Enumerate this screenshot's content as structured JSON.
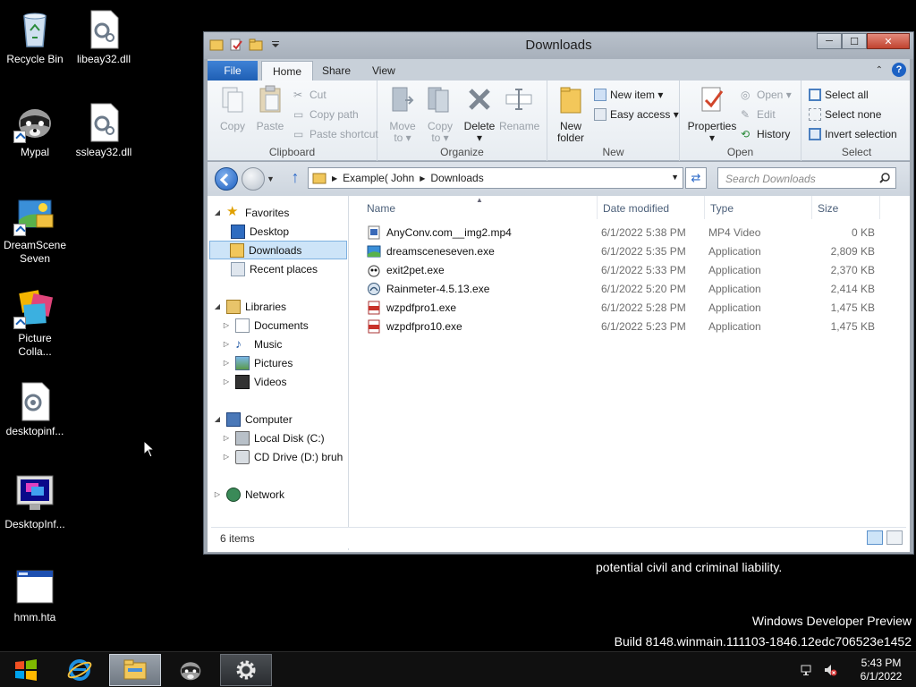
{
  "desktop": {
    "icons": [
      {
        "label": "Recycle Bin",
        "icon": "recycle-bin-icon"
      },
      {
        "label": "libeay32.dll",
        "icon": "dll-file-icon"
      },
      {
        "label": "Mypal",
        "icon": "mypal-raccoon-icon"
      },
      {
        "label": "ssleay32.dll",
        "icon": "dll-file-icon"
      },
      {
        "label": "DreamScene Seven",
        "icon": "dreamscene-icon"
      },
      {
        "label": "Picture Colla...",
        "icon": "picture-collage-icon"
      },
      {
        "label": "desktopinf...",
        "icon": "config-file-icon"
      },
      {
        "label": "DesktopInf...",
        "icon": "monitor-icon"
      },
      {
        "label": "hmm.hta",
        "icon": "hta-window-icon"
      }
    ],
    "watermark": {
      "partial_line": "potential civil and criminal liability.",
      "line1": "Windows Developer Preview",
      "line2": "Build 8148.winmain.111103-1846.12edc706523e1452"
    }
  },
  "window": {
    "title": "Downloads",
    "controls": {
      "minimize": "─",
      "maximize": "☐",
      "close": "✕"
    },
    "ribbon_tabs": [
      "File",
      "Home",
      "Share",
      "View"
    ],
    "active_tab": "Home",
    "ribbon": {
      "clipboard": {
        "label": "Clipboard",
        "copy": "Copy",
        "paste": "Paste",
        "cut": "Cut",
        "copy_path": "Copy path",
        "paste_shortcut": "Paste shortcut"
      },
      "organize": {
        "label": "Organize",
        "move_to": "Move",
        "move_to2": "to ▾",
        "copy_to": "Copy",
        "copy_to2": "to ▾",
        "delete": "Delete",
        "delete2": "▾",
        "rename": "Rename"
      },
      "new": {
        "label": "New",
        "new_folder": "New",
        "new_folder2": "folder",
        "new_item": "New item ▾",
        "easy_access": "Easy access ▾"
      },
      "open": {
        "label": "Open",
        "properties": "Properties",
        "properties2": "▾",
        "open": "Open ▾",
        "edit": "Edit",
        "history": "History"
      },
      "select": {
        "label": "Select",
        "select_all": "Select all",
        "select_none": "Select none",
        "invert": "Invert selection"
      }
    },
    "address": {
      "path": [
        "Example( John",
        "Downloads"
      ],
      "search_placeholder": "Search Downloads"
    },
    "nav_pane": {
      "favorites": "Favorites",
      "desktop": "Desktop",
      "downloads": "Downloads",
      "recent": "Recent places",
      "libraries": "Libraries",
      "documents": "Documents",
      "music": "Music",
      "pictures": "Pictures",
      "videos": "Videos",
      "computer": "Computer",
      "local_disk": "Local Disk (C:)",
      "cd_drive": "CD Drive (D:) bruh",
      "network": "Network"
    },
    "columns": {
      "name": "Name",
      "date": "Date modified",
      "type": "Type",
      "size": "Size"
    },
    "files": [
      {
        "name": "AnyConv.com__img2.mp4",
        "date": "6/1/2022 5:38 PM",
        "type": "MP4 Video",
        "size": "0 KB",
        "icon": "video-file-icon"
      },
      {
        "name": "dreamsceneseven.exe",
        "date": "6/1/2022 5:35 PM",
        "type": "Application",
        "size": "2,809 KB",
        "icon": "dreamscene-exe-icon"
      },
      {
        "name": "exit2pet.exe",
        "date": "6/1/2022 5:33 PM",
        "type": "Application",
        "size": "2,370 KB",
        "icon": "pet-exe-icon"
      },
      {
        "name": "Rainmeter-4.5.13.exe",
        "date": "6/1/2022 5:20 PM",
        "type": "Application",
        "size": "2,414 KB",
        "icon": "rainmeter-exe-icon"
      },
      {
        "name": "wzpdfpro1.exe",
        "date": "6/1/2022 5:28 PM",
        "type": "Application",
        "size": "1,475 KB",
        "icon": "pdf-exe-icon"
      },
      {
        "name": "wzpdfpro10.exe",
        "date": "6/1/2022 5:23 PM",
        "type": "Application",
        "size": "1,475 KB",
        "icon": "pdf-exe-icon"
      }
    ],
    "status": "6 items"
  },
  "taskbar": {
    "buttons": [
      "start-orb-icon",
      "internet-explorer-icon",
      "file-explorer-icon",
      "mypal-raccoon-icon",
      "settings-gear-icon"
    ],
    "clock_time": "5:43 PM",
    "clock_date": "6/1/2022"
  },
  "colors": {
    "accent": "#1f5fb4",
    "selection": "#cde4f8",
    "window_frame": "#9fa7b1",
    "desktop": "#000000"
  }
}
